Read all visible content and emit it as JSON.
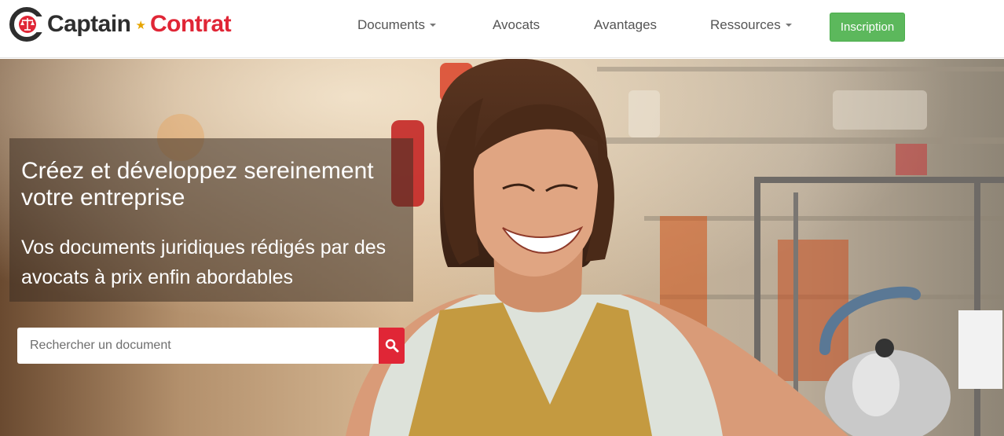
{
  "brand": {
    "name_part1": "Captain",
    "name_part2": "Contrat",
    "separator_icon": "star-icon",
    "colors": {
      "dark": "#2e2e2e",
      "red": "#e02636",
      "gold": "#e6a500"
    }
  },
  "nav": {
    "items": [
      {
        "label": "Documents",
        "dropdown": true
      },
      {
        "label": "Avocats",
        "dropdown": false
      },
      {
        "label": "Avantages",
        "dropdown": false
      },
      {
        "label": "Ressources",
        "dropdown": true
      }
    ],
    "cta_label": "Inscription",
    "cta_color": "#5cb85c"
  },
  "hero": {
    "headline": "Créez et développez sereinement votre entreprise",
    "subheadline": "Vos documents juridiques rédigés par des avocats à prix enfin abordables",
    "search": {
      "placeholder": "Rechercher un document",
      "value": "",
      "button_icon": "search-icon",
      "button_color": "#e02636"
    }
  }
}
